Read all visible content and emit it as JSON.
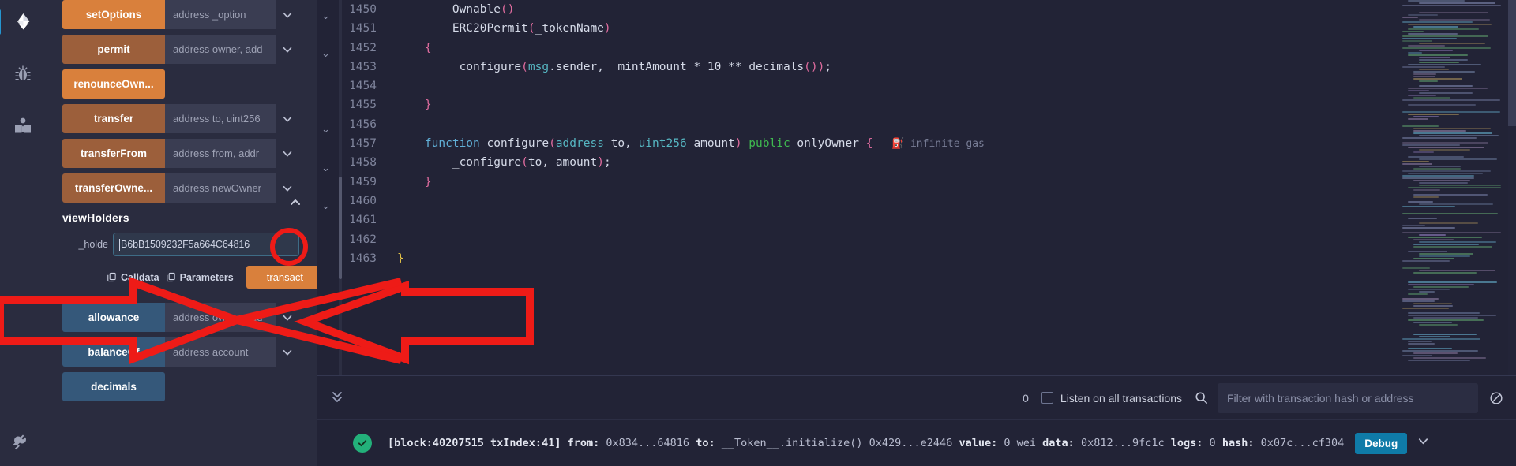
{
  "rail": {
    "items": [
      {
        "name": "deploy-run-transactions-icon",
        "glyph": "ethereum"
      },
      {
        "name": "debugger-icon",
        "glyph": "bug"
      },
      {
        "name": "documentation-icon",
        "glyph": "book"
      }
    ],
    "bottom": {
      "name": "plugin-manager-icon",
      "glyph": "plug"
    }
  },
  "udapp": {
    "functions_top": [
      {
        "label": "setOptions",
        "style": "orange",
        "placeholder": "address _option"
      },
      {
        "label": "permit",
        "style": "orange-d",
        "placeholder": "address owner, add"
      },
      {
        "label": "renounceOwn...",
        "style": "orange",
        "placeholder": ""
      },
      {
        "label": "transfer",
        "style": "orange-d",
        "placeholder": "address to, uint256"
      },
      {
        "label": "transferFrom",
        "style": "orange-d",
        "placeholder": "address from, addr"
      },
      {
        "label": "transferOwne...",
        "style": "orange-d",
        "placeholder": "address newOwner"
      }
    ],
    "expanded": {
      "title": "viewHolders",
      "collapse_icon": "chevron-up-icon",
      "param_label": "_holde",
      "param_value": "B6bB1509232F5a664C64816",
      "calldata_label": "Calldata",
      "parameters_label": "Parameters",
      "copy_icon": "copy-icon",
      "transact_label": "transact"
    },
    "functions_bottom": [
      {
        "label": "allowance",
        "style": "blue",
        "placeholder": "address owner, add"
      },
      {
        "label": "balanceOf",
        "style": "blue",
        "placeholder": "address account"
      },
      {
        "label": "decimals",
        "style": "blue",
        "placeholder": ""
      }
    ],
    "colors": {
      "orange": "#d9803c",
      "orange_dark": "#9c5f3b",
      "blue": "#35587a"
    }
  },
  "editor": {
    "first_line_number": 1450,
    "lines": [
      {
        "n": 1450,
        "text": "        Ownable()"
      },
      {
        "n": 1451,
        "text": "        ERC20Permit(_tokenName)"
      },
      {
        "n": 1452,
        "text": "    {"
      },
      {
        "n": 1453,
        "text": "        _configure(msg.sender, _mintAmount * 10 ** decimals());"
      },
      {
        "n": 1454,
        "text": ""
      },
      {
        "n": 1455,
        "text": "    }"
      },
      {
        "n": 1456,
        "text": ""
      },
      {
        "n": 1457,
        "text": "    function configure(address to, uint256 amount) public onlyOwner {"
      },
      {
        "n": 1458,
        "text": "        _configure(to, amount);"
      },
      {
        "n": 1459,
        "text": "    }"
      },
      {
        "n": 1460,
        "text": ""
      },
      {
        "n": 1461,
        "text": ""
      },
      {
        "n": 1462,
        "text": ""
      },
      {
        "n": 1463,
        "text": "}"
      }
    ],
    "gas_hint": "infinite gas",
    "gas_icon": "fuel-pump-icon"
  },
  "terminal": {
    "expand_icon": "double-chevron-down-icon",
    "pending_count": "0",
    "listen_label": "Listen on all transactions",
    "listen_checked": false,
    "search_icon": "search-icon",
    "filter_placeholder": "Filter with transaction hash or address",
    "clear_icon": "no-entry-icon",
    "log": {
      "status_icon": "check-circle-icon",
      "block_label": "[block:40207515 txIndex:41]",
      "from_key": "from:",
      "from_value": "0x834...64816",
      "to_key": "to:",
      "to_value": "__Token__.initialize() 0x429...e2446",
      "value_key": "value:",
      "value_value": "0 wei",
      "data_key": "data:",
      "data_value": "0x812...9fc1c",
      "logs_key": "logs:",
      "logs_value": "0",
      "hash_key": "hash:",
      "hash_value": "0x07c...cf304",
      "debug_label": "Debug",
      "expand_icon": "chevron-down-icon"
    }
  },
  "annotations": {
    "color": "#ee1b17",
    "ring_target": "viewHolders collapse chevron",
    "arrow_target": "transact button"
  }
}
